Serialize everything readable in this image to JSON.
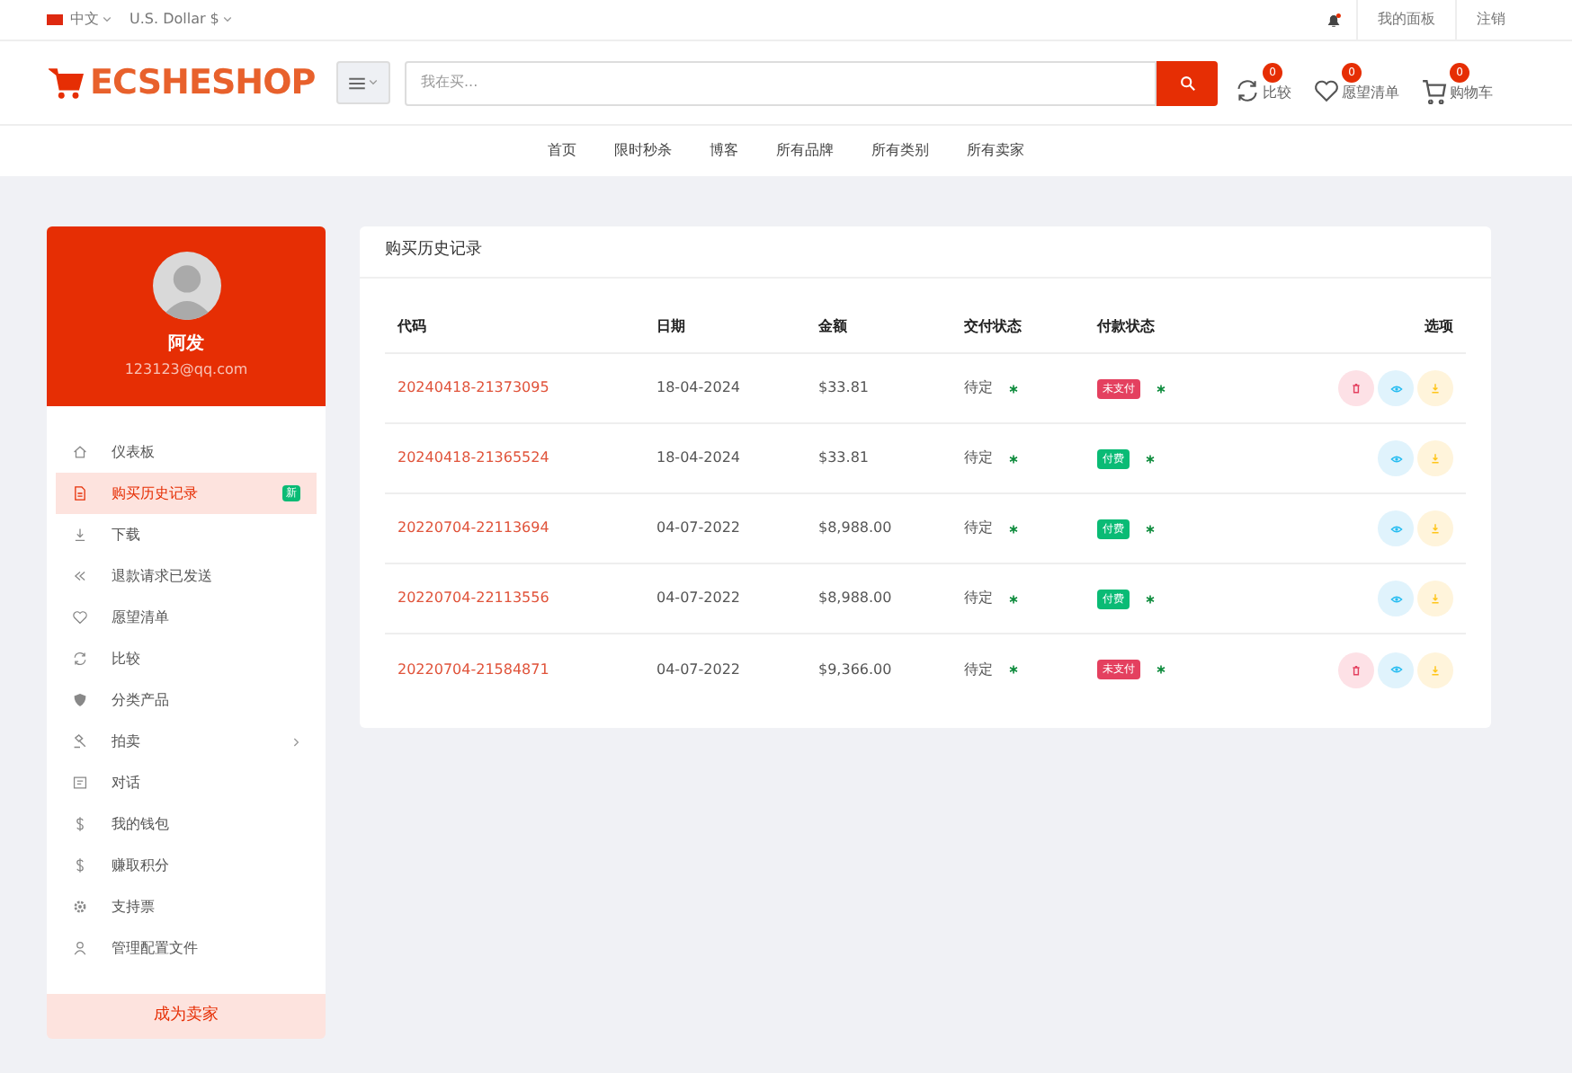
{
  "topbar": {
    "language": "中文",
    "currency": "U.S. Dollar $",
    "links": [
      "我的面板",
      "注销"
    ]
  },
  "header": {
    "logo": "ECSHESHOP",
    "search_placeholder": "我在买...",
    "actions": [
      {
        "kind": "compare",
        "label": "比较",
        "count": "0"
      },
      {
        "kind": "wishlist",
        "label": "愿望清单",
        "count": "0"
      },
      {
        "kind": "cart",
        "label": "购物车",
        "count": "0"
      }
    ]
  },
  "nav": [
    "首页",
    "限时秒杀",
    "博客",
    "所有品牌",
    "所有类别",
    "所有卖家"
  ],
  "profile": {
    "name": "阿发",
    "email": "123123@qq.com"
  },
  "sidebar": {
    "items": [
      {
        "kind": "home",
        "label": "仪表板",
        "selected": false
      },
      {
        "kind": "file",
        "label": "购买历史记录",
        "selected": true,
        "badge": "新"
      },
      {
        "kind": "download",
        "label": "下载",
        "selected": false
      },
      {
        "kind": "refund",
        "label": "退款请求已发送",
        "selected": false
      },
      {
        "kind": "heart",
        "label": "愿望清单",
        "selected": false
      },
      {
        "kind": "compare",
        "label": "比较",
        "selected": false
      },
      {
        "kind": "shield",
        "label": "分类产品",
        "selected": false
      },
      {
        "kind": "gavel",
        "label": "拍卖",
        "selected": false,
        "expandable": true
      },
      {
        "kind": "chat",
        "label": "对话",
        "selected": false
      },
      {
        "kind": "dollar",
        "label": "我的钱包",
        "selected": false
      },
      {
        "kind": "dollar",
        "label": "赚取积分",
        "selected": false
      },
      {
        "kind": "gear",
        "label": "支持票",
        "selected": false
      },
      {
        "kind": "user",
        "label": "管理配置文件",
        "selected": false
      }
    ],
    "footer_button": "成为卖家"
  },
  "panel": {
    "title": "购买历史记录",
    "table": {
      "columns": [
        "代码",
        "日期",
        "金额",
        "交付状态",
        "付款状态",
        "选项"
      ],
      "rows": [
        {
          "code": "20240418-21373095",
          "date": "18-04-2024",
          "amount": "$33.81",
          "delivery": "待定",
          "payment": {
            "label": "未支付",
            "kind": "unpaid"
          },
          "can_delete": true
        },
        {
          "code": "20240418-21365524",
          "date": "18-04-2024",
          "amount": "$33.81",
          "delivery": "待定",
          "payment": {
            "label": "付费",
            "kind": "paid"
          },
          "can_delete": false
        },
        {
          "code": "20220704-22113694",
          "date": "04-07-2022",
          "amount": "$8,988.00",
          "delivery": "待定",
          "payment": {
            "label": "付费",
            "kind": "paid"
          },
          "can_delete": false
        },
        {
          "code": "20220704-22113556",
          "date": "04-07-2022",
          "amount": "$8,988.00",
          "delivery": "待定",
          "payment": {
            "label": "付费",
            "kind": "paid"
          },
          "can_delete": false
        },
        {
          "code": "20220704-21584871",
          "date": "04-07-2022",
          "amount": "$9,366.00",
          "delivery": "待定",
          "payment": {
            "label": "未支付",
            "kind": "unpaid"
          },
          "can_delete": true
        }
      ]
    }
  }
}
